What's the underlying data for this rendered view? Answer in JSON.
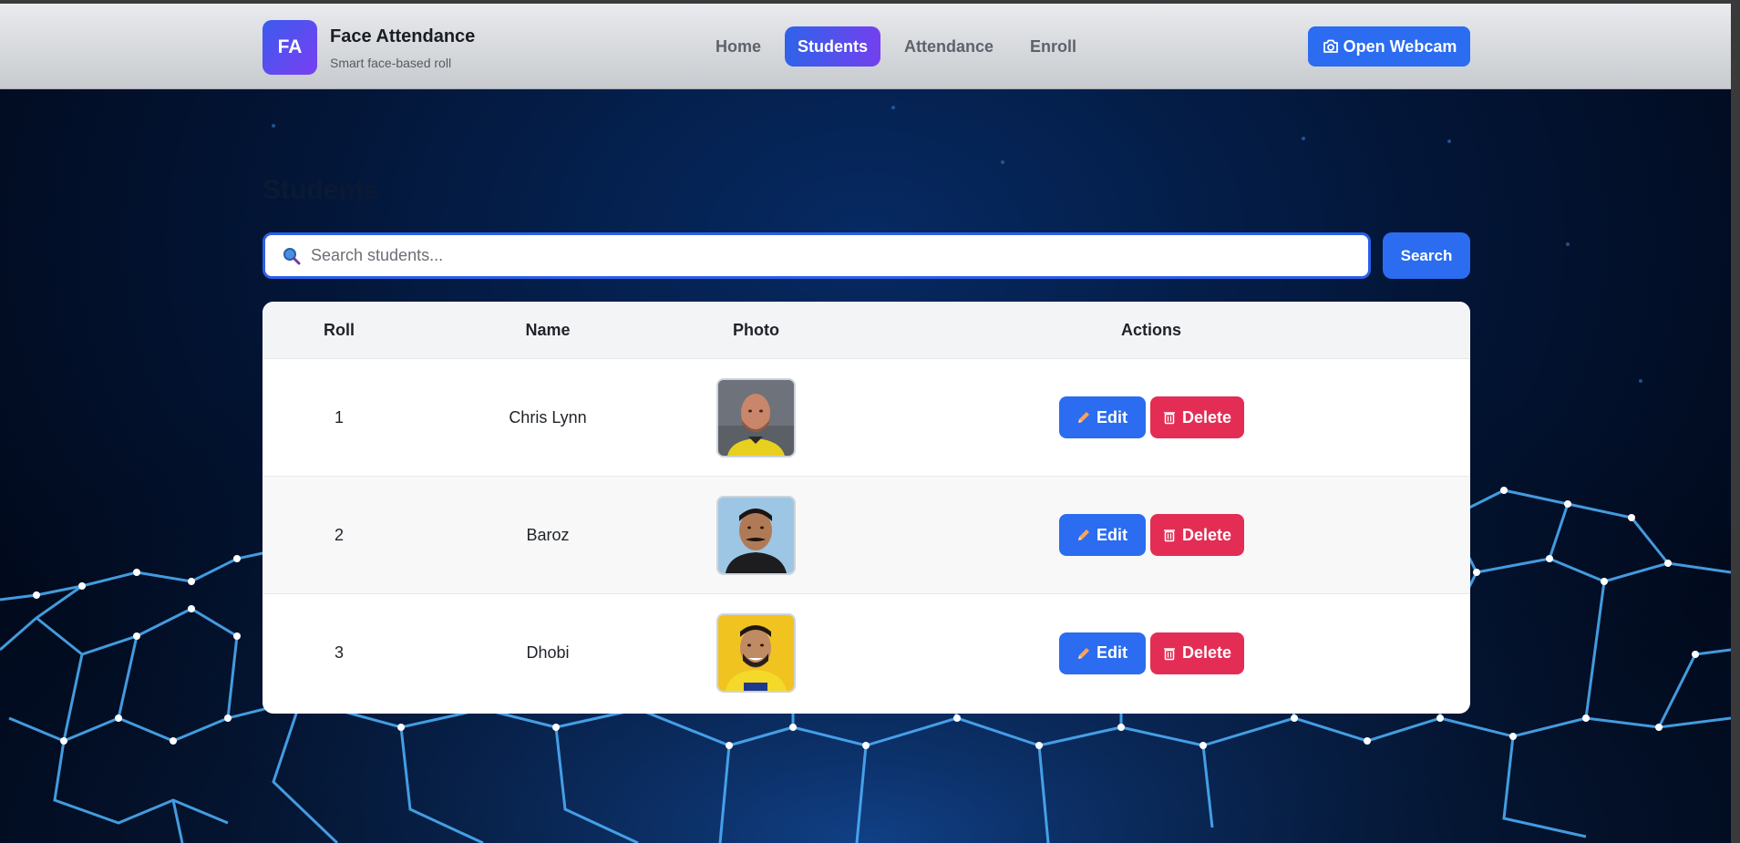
{
  "header": {
    "logo_text": "FA",
    "title": "Face Attendance",
    "subtitle": "Smart face-based roll",
    "nav": [
      {
        "label": "Home",
        "active": false
      },
      {
        "label": "Students",
        "active": true
      },
      {
        "label": "Attendance",
        "active": false
      },
      {
        "label": "Enroll",
        "active": false
      }
    ],
    "webcam_label": "Open Webcam"
  },
  "page": {
    "title": "Students"
  },
  "search": {
    "placeholder": "Search students...",
    "value": "",
    "button_label": "Search"
  },
  "table": {
    "headers": [
      "Roll",
      "Name",
      "Photo",
      "Actions"
    ],
    "rows": [
      {
        "roll": "1",
        "name": "Chris Lynn",
        "photo_icon": "portrait-bald-man-yellow-jersey"
      },
      {
        "roll": "2",
        "name": "Baroz",
        "photo_icon": "portrait-mustache-man-dark-shirt"
      },
      {
        "roll": "3",
        "name": "Dhobi",
        "photo_icon": "portrait-bearded-man-yellow-jersey"
      }
    ],
    "edit_label": "Edit",
    "delete_label": "Delete"
  },
  "colors": {
    "accent": "#2b6cf0",
    "delete": "#e42d55",
    "nav_active_start": "#2f63ea",
    "nav_active_end": "#7340ee"
  }
}
